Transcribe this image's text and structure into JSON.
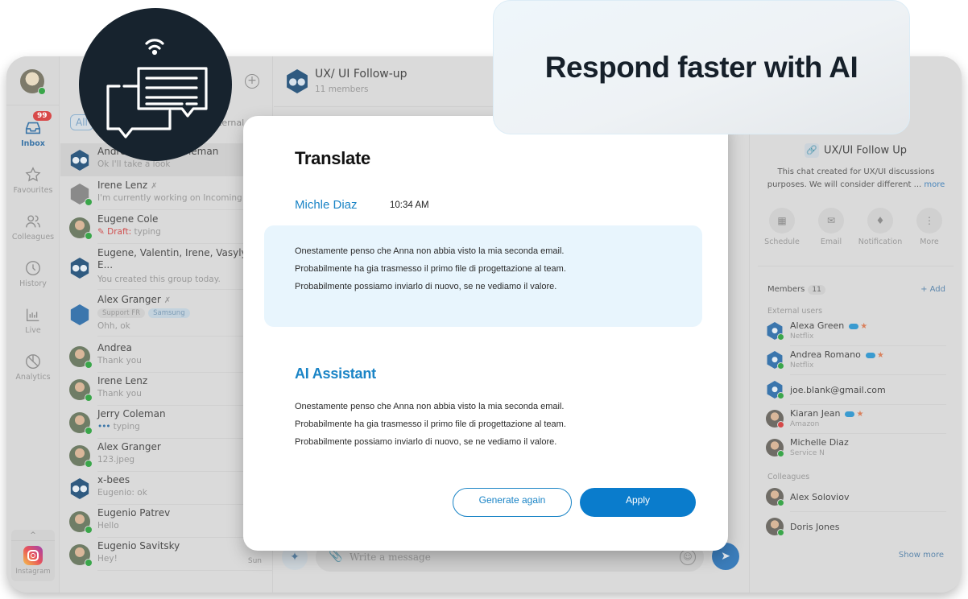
{
  "headline": "Respond faster with AI",
  "brand_colors": {
    "primary_blue": "#0a7ccc",
    "accent_blue": "#1a84c6",
    "logo_dark": "#17232e",
    "online_green": "#3aa64a",
    "busy_red": "#d54848"
  },
  "rail": {
    "user_status": "online",
    "items": [
      {
        "icon": "inbox-icon",
        "label": "Inbox",
        "badge": "99",
        "active": true
      },
      {
        "icon": "star-icon",
        "label": "Favourites"
      },
      {
        "icon": "users-icon",
        "label": "Colleagues"
      },
      {
        "icon": "clock-icon",
        "label": "History"
      },
      {
        "icon": "bar-chart-icon",
        "label": "Live"
      },
      {
        "icon": "pie-chart-icon",
        "label": "Analytics"
      }
    ],
    "integration": {
      "label": "Instagram",
      "chevron": "^"
    }
  },
  "chat_list": {
    "add_icon": "+",
    "filters": {
      "all": "All",
      "external": "ternal"
    },
    "chats": [
      {
        "name": "Andrea, ... Jerry Coleman",
        "preview": "Ok I'll take a look",
        "type": "group",
        "selected": true
      },
      {
        "name": "Irene Lenz",
        "preview": "I'm currently working on Incoming mes...",
        "muted": true,
        "status": "online"
      },
      {
        "name": "Eugene Cole",
        "draft_label": "Draft:",
        "preview": "typing",
        "status": "online"
      },
      {
        "name": "Eugene, Valentin, Irene, Vasyly,",
        "name_line2": "E...",
        "preview": "You created this group today.",
        "type": "group"
      },
      {
        "name": "Alex Granger",
        "muted": true,
        "tags": [
          "Support FR",
          "Samsung"
        ],
        "preview": "Ohh, ok"
      },
      {
        "name": "Andrea",
        "preview": "Thank you",
        "status": "online"
      },
      {
        "name": "Irene Lenz",
        "preview": "Thank you",
        "status": "online"
      },
      {
        "name": "Jerry Coleman",
        "typing_dots": "•••",
        "preview": "typing",
        "status": "online"
      },
      {
        "name": "Alex Granger",
        "preview": "123.jpeg",
        "status": "online"
      },
      {
        "name": "x-bees",
        "preview": "Eugenio: ok",
        "type": "group"
      },
      {
        "name": "Eugenio Patrev",
        "preview": "Hello",
        "status": "online"
      },
      {
        "name": "Eugenio Savitsky",
        "preview": "Hey!",
        "time": "Sun",
        "status": "online"
      }
    ]
  },
  "conversation": {
    "title": "UX/ UI Follow-up",
    "subtitle": "11 members",
    "composer": {
      "placeholder": "Write a message"
    }
  },
  "modal": {
    "title": "Translate",
    "author": "Michle Diaz",
    "time": "10:34 AM",
    "original_lines": [
      "Onestamente penso che Anna non abbia visto la mia seconda email.",
      "Probabilmente ha gia trasmesso il primo file di progettazione al team.",
      "Probabilmente possiamo inviarlo di nuovo, se ne vediamo il valore."
    ],
    "ai_title": "AI Assistant",
    "ai_lines": [
      "Onestamente penso che Anna non abbia visto la mia seconda email.",
      "Probabilmente ha gia trasmesso il primo file di progettazione al team.",
      "Probabilmente possiamo inviarlo di nuovo, se ne vediamo il valore."
    ],
    "regenerate_label": "Generate again",
    "apply_label": "Apply"
  },
  "details": {
    "title": "UX/UI Follow Up",
    "description": "This chat created for UX/UI discussions purposes. We will consider different ...",
    "more_link": "more",
    "actions": [
      {
        "icon": "calendar-icon",
        "label": "Schedule"
      },
      {
        "icon": "mail-icon",
        "label": "Email"
      },
      {
        "icon": "bell-icon",
        "label": "Notification"
      },
      {
        "icon": "more-vertical-icon",
        "label": "More"
      }
    ],
    "members_label": "Members",
    "members_count": "11",
    "add_label": "+ Add",
    "external_label": "External users",
    "external": [
      {
        "name": "Alexa Green",
        "org": "Netflix",
        "status": "online",
        "salesforce": true,
        "starred": true
      },
      {
        "name": "Andrea Romano",
        "org": "Netflix",
        "status": "online",
        "salesforce": true,
        "starred": true
      },
      {
        "name": "joe.blank@gmail.com",
        "status": "online"
      },
      {
        "name": "Kiaran Jean",
        "org": "Amazon",
        "status": "busy",
        "salesforce": true,
        "starred": true
      },
      {
        "name": "Michelle Diaz",
        "org": "Service N",
        "status": "online"
      }
    ],
    "colleagues_label": "Colleagues",
    "colleagues": [
      {
        "name": "Alex Soloviov",
        "status": "online"
      },
      {
        "name": "Doris Jones",
        "status": "online"
      }
    ],
    "show_more": "Show more"
  }
}
